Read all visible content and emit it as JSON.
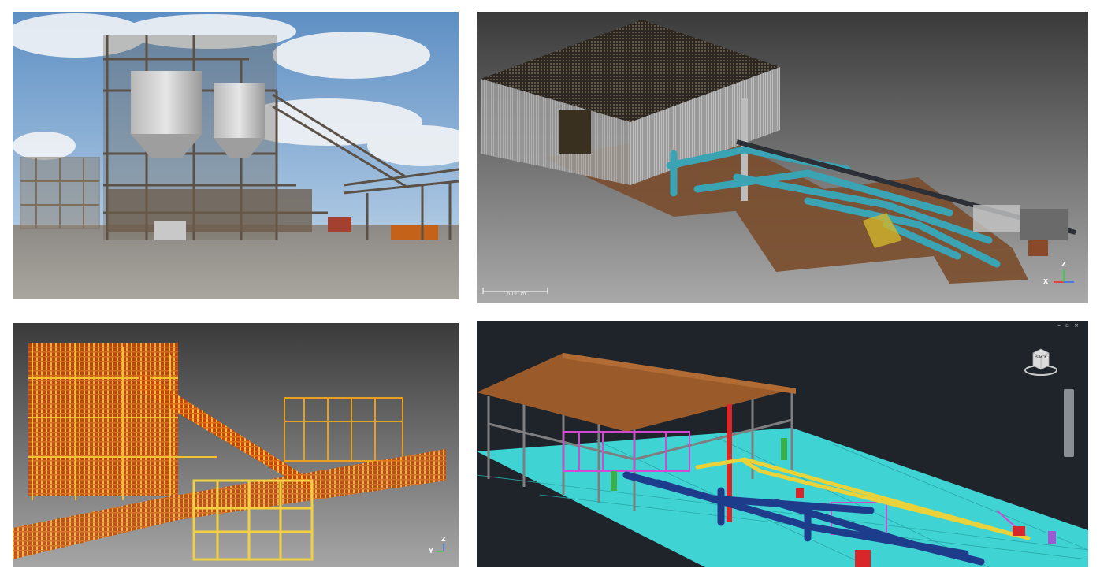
{
  "panels": {
    "photo": {
      "name": "Industrial plant photograph"
    },
    "point_cloud_rgb": {
      "scale_label": "6.00 m",
      "axis_x": "X",
      "axis_z": "Z"
    },
    "point_cloud_intensity": {
      "axis_y": "Y",
      "axis_z": "Z"
    },
    "cad_model": {
      "view_cube_label": "BACK",
      "window_controls": "– ▫ ×"
    }
  },
  "colors": {
    "sky": "#6f9cc9",
    "point_cloud_bg_top": "#3a3a3a",
    "point_cloud_bg_bottom": "#a9a9a9",
    "cad_bg": "#1f242b",
    "cad_floor": "#3fd3d3",
    "cad_roof": "#9a5a2a",
    "cad_pipe_blue": "#1e3c8c",
    "cad_pipe_yellow": "#e9d23a",
    "cad_magenta": "#d24ad2",
    "cad_red": "#d8262a",
    "pipe_teal": "#3aa4b4",
    "intensity_orange": "#e0701a",
    "intensity_yellow": "#f2c230"
  }
}
